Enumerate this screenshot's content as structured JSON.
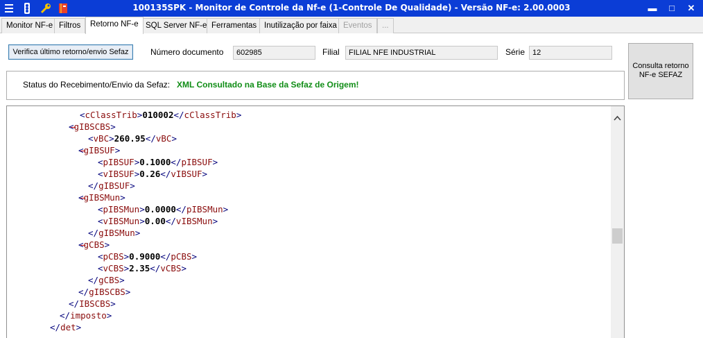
{
  "window": {
    "title": "100135SPK - Monitor de Controle da Nf-e (1-Controle De Qualidade) - Versão NF-e: 2.00.0003",
    "minimize_label": "▬",
    "maximize_label": "□",
    "close_label": "✕",
    "title_color": "#0b3dd6"
  },
  "tabs": [
    {
      "label": "Monitor NF-e",
      "state": "normal"
    },
    {
      "label": "Filtros",
      "state": "normal"
    },
    {
      "label": "Retorno NF-e",
      "state": "active"
    },
    {
      "label": "SQL Server NF-e",
      "state": "normal"
    },
    {
      "label": "Ferramentas",
      "state": "normal"
    },
    {
      "label": "Inutilização por faixa",
      "state": "normal"
    },
    {
      "label": "Eventos",
      "state": "disabled"
    },
    {
      "label": "...",
      "state": "disabled"
    }
  ],
  "form": {
    "verifica_button": "Verifica último retorno/envio Sefaz",
    "numero_label": "Número documento",
    "numero_value": "602985",
    "filial_label": "Filial",
    "filial_value": "FILIAL NFE INDUSTRIAL",
    "serie_label": "Série",
    "serie_value": "12",
    "consulta_button": "Consulta retorno NF-e SEFAZ"
  },
  "status": {
    "label": "Status do Recebimento/Envio da Sefaz:",
    "value": "XML Consultado na Base da Sefaz de Origem!",
    "value_color": "#108d16"
  },
  "xml": {
    "lines": [
      {
        "minus": false,
        "open": "cClassTrib",
        "value": "010002",
        "close": "cClassTrib"
      },
      {
        "minus": true,
        "open": "gIBSCBS",
        "value": "",
        "close": ""
      },
      {
        "minus": false,
        "open": "vBC",
        "value": "260.95",
        "close": "vBC"
      },
      {
        "minus": true,
        "open": "gIBSUF",
        "value": "",
        "close": ""
      },
      {
        "minus": false,
        "open": "pIBSUF",
        "value": "0.1000",
        "close": "pIBSUF"
      },
      {
        "minus": false,
        "open": "vIBSUF",
        "value": "0.26",
        "close": "vIBSUF"
      },
      {
        "minus": false,
        "open": "",
        "value": "",
        "close": "gIBSUF"
      },
      {
        "minus": true,
        "open": "gIBSMun",
        "value": "",
        "close": ""
      },
      {
        "minus": false,
        "open": "pIBSMun",
        "value": "0.0000",
        "close": "pIBSMun"
      },
      {
        "minus": false,
        "open": "vIBSMun",
        "value": "0.00",
        "close": "vIBSMun"
      },
      {
        "minus": false,
        "open": "",
        "value": "",
        "close": "gIBSMun"
      },
      {
        "minus": true,
        "open": "gCBS",
        "value": "",
        "close": ""
      },
      {
        "minus": false,
        "open": "pCBS",
        "value": "0.9000",
        "close": "pCBS"
      },
      {
        "minus": false,
        "open": "vCBS",
        "value": "2.35",
        "close": "vCBS"
      },
      {
        "minus": false,
        "open": "",
        "value": "",
        "close": "gCBS"
      },
      {
        "minus": false,
        "open": "",
        "value": "",
        "close": "gIBSCBS"
      },
      {
        "minus": false,
        "open": "",
        "value": "",
        "close": "IBSCBS"
      },
      {
        "minus": false,
        "open": "",
        "value": "",
        "close": "imposto"
      },
      {
        "minus": false,
        "open": "",
        "value": "",
        "close": "det"
      }
    ]
  },
  "icons": [
    "menu-icon",
    "traffic-light-icon",
    "wrench-icon",
    "book-icon"
  ]
}
